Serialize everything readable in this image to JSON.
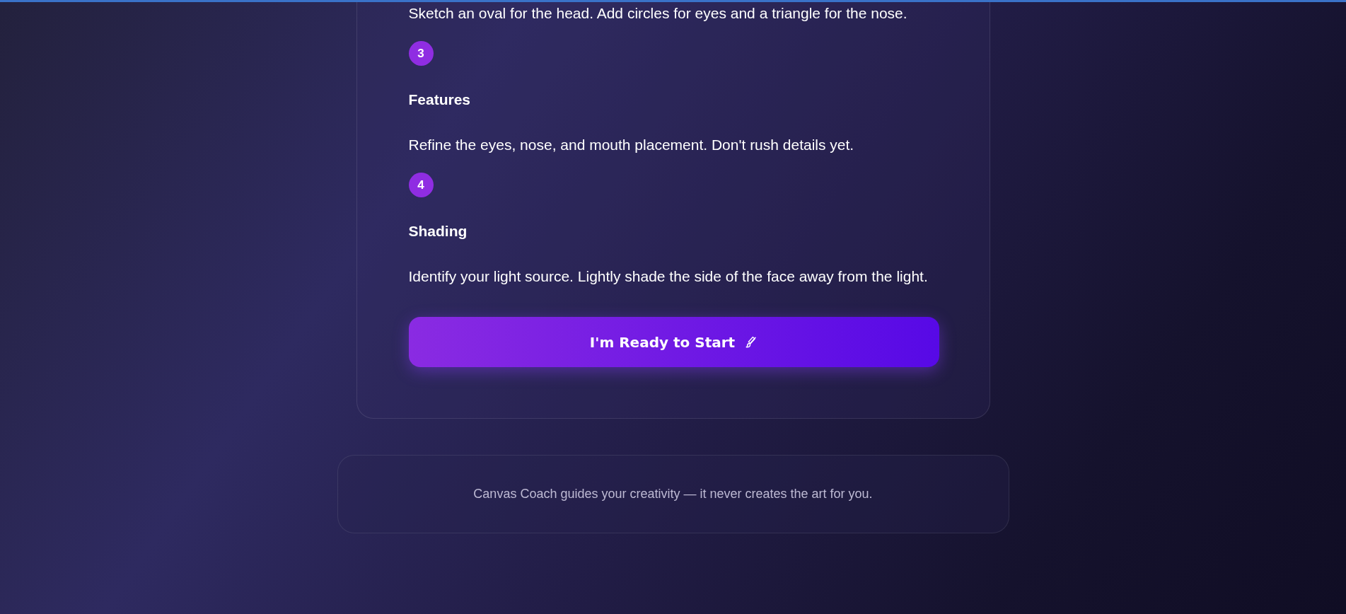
{
  "steps": [
    {
      "description": "Sketch an oval for the head. Add circles for eyes and a triangle for the nose."
    },
    {
      "number": "3",
      "title": "Features",
      "description": "Refine the eyes, nose, and mouth placement. Don't rush details yet."
    },
    {
      "number": "4",
      "title": "Shading",
      "description": "Identify your light source. Lightly shade the side of the face away from the light."
    }
  ],
  "start_button": {
    "label": "I'm Ready to Start"
  },
  "footer": {
    "text": "Canvas Coach guides your creativity — it never creates the art for you."
  }
}
